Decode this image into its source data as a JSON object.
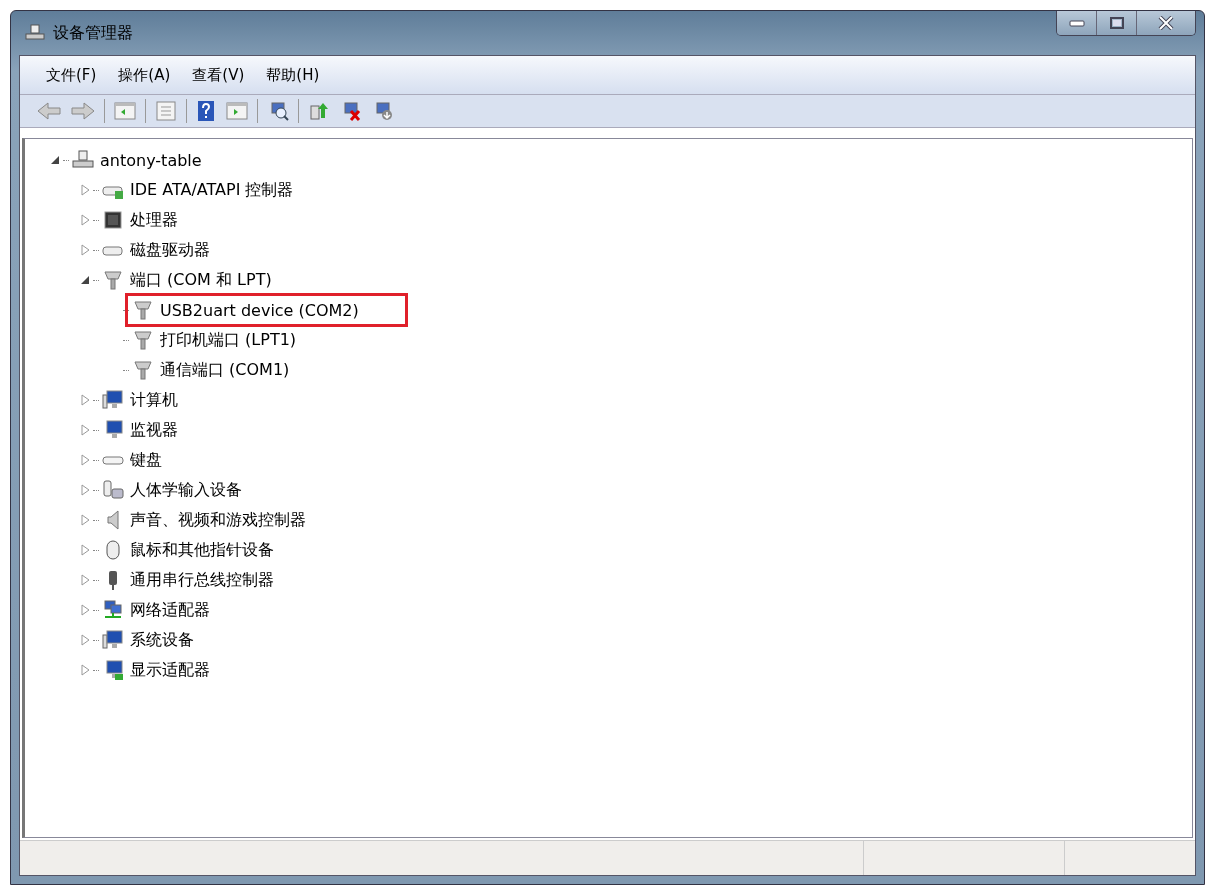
{
  "window": {
    "title": "设备管理器"
  },
  "menu": [
    "文件(F)",
    "操作(A)",
    "查看(V)",
    "帮助(H)"
  ],
  "tree": [
    {
      "label": "antony-table",
      "kind": "computer",
      "expanded": true,
      "children": [
        {
          "label": "IDE ATA/ATAPI 控制器",
          "kind": "disk",
          "expanded": false
        },
        {
          "label": "处理器",
          "kind": "chip",
          "expanded": false
        },
        {
          "label": "磁盘驱动器",
          "kind": "drive",
          "expanded": false
        },
        {
          "label": "端口 (COM 和 LPT)",
          "kind": "port",
          "expanded": true,
          "children": [
            {
              "label": "USB2uart device (COM2)",
              "kind": "port",
              "highlighted": true
            },
            {
              "label": "打印机端口 (LPT1)",
              "kind": "port",
              "highlighted": false
            },
            {
              "label": "通信端口 (COM1)",
              "kind": "port",
              "highlighted": false
            }
          ]
        },
        {
          "label": "计算机",
          "kind": "system",
          "expanded": false
        },
        {
          "label": "监视器",
          "kind": "monitor",
          "expanded": false
        },
        {
          "label": "键盘",
          "kind": "keyboard",
          "expanded": false
        },
        {
          "label": "人体学输入设备",
          "kind": "hid",
          "expanded": false
        },
        {
          "label": "声音、视频和游戏控制器",
          "kind": "sound",
          "expanded": false
        },
        {
          "label": "鼠标和其他指针设备",
          "kind": "mouse",
          "expanded": false
        },
        {
          "label": "通用串行总线控制器",
          "kind": "usb",
          "expanded": false
        },
        {
          "label": "网络适配器",
          "kind": "network",
          "expanded": false
        },
        {
          "label": "系统设备",
          "kind": "system",
          "expanded": false
        },
        {
          "label": "显示适配器",
          "kind": "display",
          "expanded": false
        }
      ]
    }
  ]
}
